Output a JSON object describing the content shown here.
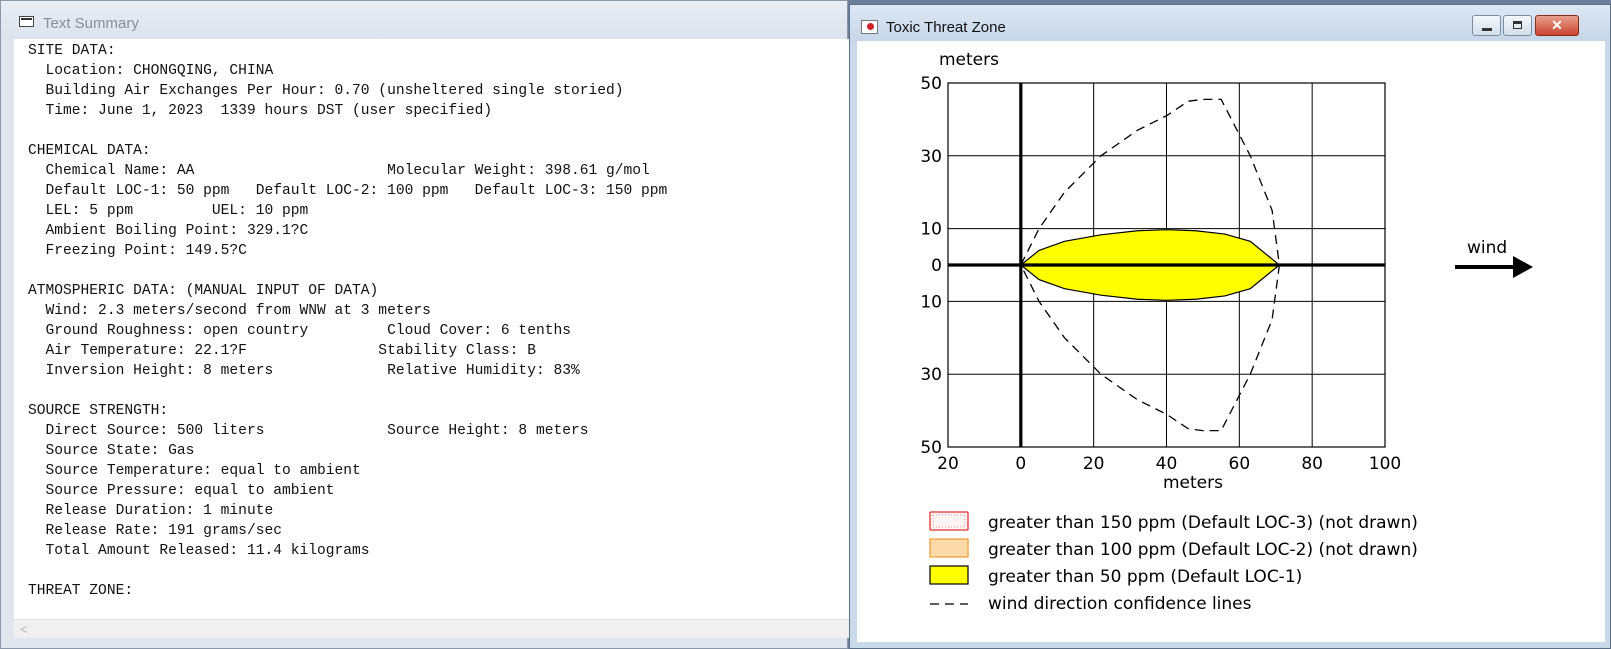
{
  "summary_window": {
    "title": "Text Summary",
    "text": "SITE DATA:\n  Location: CHONGQING, CHINA\n  Building Air Exchanges Per Hour: 0.70 (unsheltered single storied)\n  Time: June 1, 2023  1339 hours DST (user specified)\n\nCHEMICAL DATA:\n  Chemical Name: AA                      Molecular Weight: 398.61 g/mol\n  Default LOC-1: 50 ppm   Default LOC-2: 100 ppm   Default LOC-3: 150 ppm\n  LEL: 5 ppm         UEL: 10 ppm\n  Ambient Boiling Point: 329.1?C\n  Freezing Point: 149.5?C\n\nATMOSPHERIC DATA: (MANUAL INPUT OF DATA)\n  Wind: 2.3 meters/second from WNW at 3 meters\n  Ground Roughness: open country         Cloud Cover: 6 tenths\n  Air Temperature: 22.1?F               Stability Class: B\n  Inversion Height: 8 meters             Relative Humidity: 83%\n\nSOURCE STRENGTH:\n  Direct Source: 500 liters              Source Height: 8 meters\n  Source State: Gas\n  Source Temperature: equal to ambient\n  Source Pressure: equal to ambient\n  Release Duration: 1 minute\n  Release Rate: 191 grams/sec\n  Total Amount Released: 11.4 kilograms\n\nTHREAT ZONE:",
    "scroll_left_glyph": "<"
  },
  "threat_window": {
    "title": "Toxic Threat Zone",
    "close_glyph": "✕",
    "wind_label": "wind"
  },
  "chart_data": {
    "type": "area",
    "xlabel": "meters",
    "ylabel": "meters",
    "xlim": [
      -20,
      100
    ],
    "ylim": [
      -50,
      50
    ],
    "x_ticks": [
      -20,
      0,
      20,
      40,
      60,
      80,
      100
    ],
    "x_tick_labels": [
      "20",
      "0",
      "20",
      "40",
      "60",
      "80",
      "100"
    ],
    "y_ticks": [
      50,
      30,
      10,
      0,
      -10,
      -30,
      -50
    ],
    "y_tick_labels": [
      "50",
      "30",
      "10",
      "0",
      "10",
      "30",
      "50"
    ],
    "grid": true,
    "series": [
      {
        "name": "greater than 50 ppm (Default LOC-1)",
        "color": "#ffff00",
        "x": [
          0,
          5,
          12,
          22,
          32,
          40,
          48,
          56,
          63,
          71,
          63,
          56,
          48,
          40,
          32,
          22,
          12,
          5,
          0
        ],
        "y": [
          0,
          4,
          6.5,
          8.3,
          9.4,
          9.7,
          9.4,
          8.5,
          6.5,
          0,
          -6.5,
          -8.5,
          -9.4,
          -9.7,
          -9.4,
          -8.3,
          -6.5,
          -4,
          0
        ]
      },
      {
        "name": "wind direction confidence lines",
        "color": "#000000",
        "dashed": true,
        "x": [
          0,
          5,
          12,
          22,
          32,
          40,
          46,
          50,
          55,
          63,
          69,
          71,
          69,
          63,
          55,
          50,
          46,
          40,
          32,
          22,
          12,
          5,
          0
        ],
        "y": [
          0,
          10,
          20,
          30,
          37,
          41,
          45,
          45.5,
          45.5,
          30,
          15,
          0,
          -15,
          -30,
          -45.5,
          -45.5,
          -45,
          -41,
          -37,
          -30,
          -20,
          -10,
          0
        ]
      }
    ],
    "legend": [
      {
        "label": "greater than 150 ppm (Default LOC-3) (not drawn)",
        "swatch": "dotted-red"
      },
      {
        "label": "greater than 100 ppm (Default LOC-2) (not drawn)",
        "swatch": "dotted-orange"
      },
      {
        "label": "greater than 50 ppm (Default LOC-1)",
        "swatch": "solid-yellow"
      },
      {
        "label": "wind direction confidence lines",
        "swatch": "dash"
      }
    ],
    "legend_position": "bottom-left"
  }
}
